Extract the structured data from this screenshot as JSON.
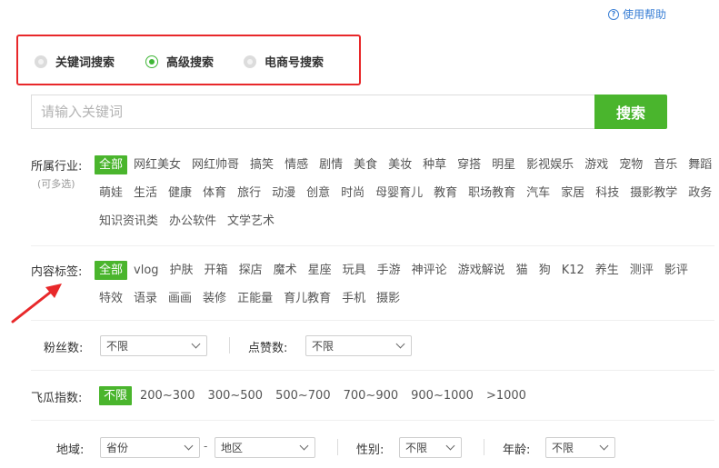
{
  "help": {
    "label": "使用帮助"
  },
  "search_modes": [
    {
      "label": "关键词搜索",
      "checked": false
    },
    {
      "label": "高级搜索",
      "checked": true
    },
    {
      "label": "电商号搜索",
      "checked": false
    }
  ],
  "search": {
    "placeholder": "请输入关键词",
    "button_label": "搜索"
  },
  "accent_color": "#4ab52d",
  "highlight_color": "#e8282a",
  "industry": {
    "label": "所属行业:",
    "hint": "(可多选)",
    "tags": [
      "全部",
      "网红美女",
      "网红帅哥",
      "搞笑",
      "情感",
      "剧情",
      "美食",
      "美妆",
      "种草",
      "穿搭",
      "明星",
      "影视娱乐",
      "游戏",
      "宠物",
      "音乐",
      "舞蹈",
      "萌娃",
      "生活",
      "健康",
      "体育",
      "旅行",
      "动漫",
      "创意",
      "时尚",
      "母婴育儿",
      "教育",
      "职场教育",
      "汽车",
      "家居",
      "科技",
      "摄影教学",
      "政务",
      "知识资讯类",
      "办公软件",
      "文学艺术"
    ]
  },
  "content_tags": {
    "label": "内容标签:",
    "tags": [
      "全部",
      "vlog",
      "护肤",
      "开箱",
      "探店",
      "魔术",
      "星座",
      "玩具",
      "手游",
      "神评论",
      "游戏解说",
      "猫",
      "狗",
      "K12",
      "养生",
      "测评",
      "影评",
      "特效",
      "语录",
      "画画",
      "装修",
      "正能量",
      "育儿教育",
      "手机",
      "摄影"
    ]
  },
  "fans": {
    "label": "粉丝数:",
    "value": "不限"
  },
  "likes": {
    "label": "点赞数:",
    "value": "不限"
  },
  "feigua_index": {
    "label": "飞瓜指数:",
    "options": [
      "不限",
      "200~300",
      "300~500",
      "500~700",
      "700~900",
      "900~1000",
      ">1000"
    ]
  },
  "region": {
    "label": "地域:",
    "province": "省份",
    "separator": "-",
    "district": "地区"
  },
  "gender": {
    "label": "性别:",
    "value": "不限"
  },
  "age": {
    "label": "年龄:",
    "value": "不限"
  }
}
